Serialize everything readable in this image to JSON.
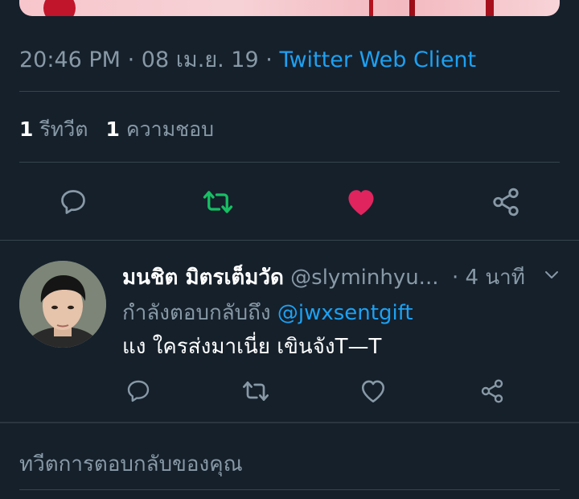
{
  "tweet": {
    "time": "20:46 PM",
    "date": "08 เม.ย. 19",
    "client": "Twitter Web Client",
    "separator": "·",
    "retweet_count": "1",
    "retweet_label": "รีทวีต",
    "like_count": "1",
    "like_label": "ความชอบ"
  },
  "actions": {
    "reply_icon": "reply-icon",
    "retweet_icon": "retweet-icon",
    "like_icon": "heart-icon",
    "share_icon": "share-icon",
    "retweet_color": "#17bf63",
    "like_color": "#e0245e"
  },
  "reply": {
    "name": "มนชิต มิตรเต็มวัด",
    "handle": "@slyminhyu...",
    "time": "· 4 นาที",
    "replying_prefix": "กำลังตอบกลับถึง",
    "replying_to": "@jwxsentgift",
    "text": "แง ใครส่งมาเนี่ย เขินจังT—T"
  },
  "composer": {
    "placeholder": "ทวีตการตอบกลับของคุณ"
  },
  "colors": {
    "background": "#15202b",
    "divider": "#38444d",
    "muted": "#8899a6",
    "link": "#1da1f2"
  }
}
